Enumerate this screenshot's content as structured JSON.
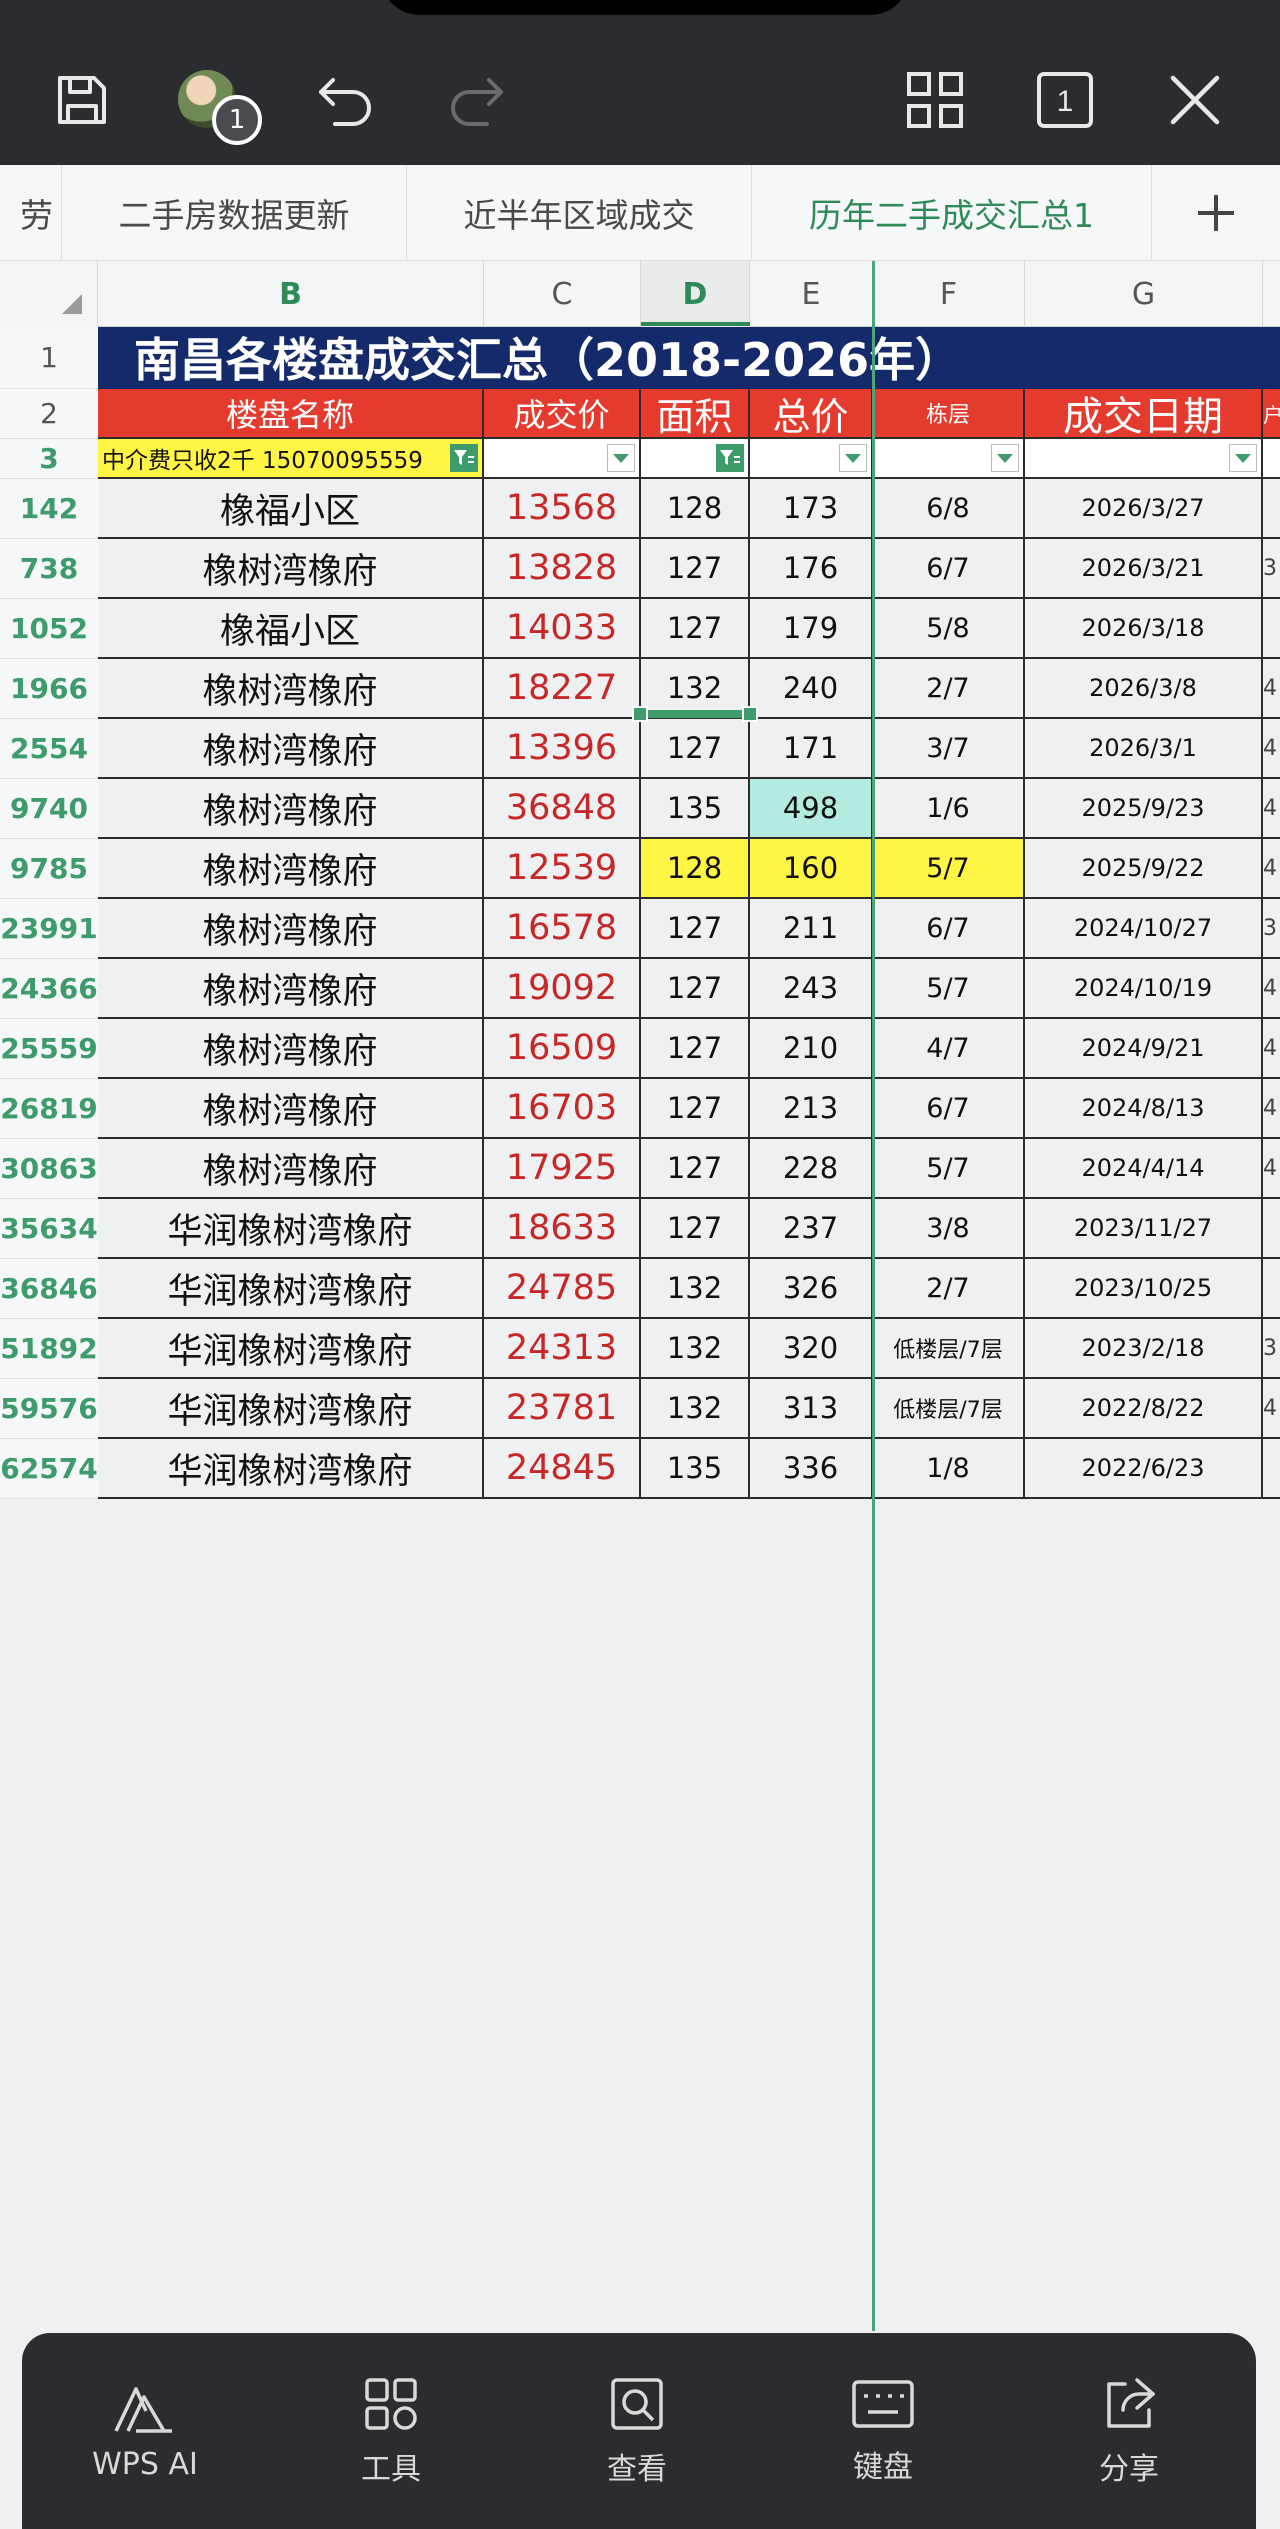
{
  "toolbar": {
    "avatar_badge": "1",
    "window_count": "1"
  },
  "tabs": [
    {
      "label": "劳"
    },
    {
      "label": "二手房数据更新"
    },
    {
      "label": "近半年区域成交"
    },
    {
      "label": "历年二手成交汇总1"
    }
  ],
  "columns": [
    "B",
    "C",
    "D",
    "E",
    "F",
    "G"
  ],
  "header_rows": {
    "r1": "1",
    "r2": "2",
    "r3": "3"
  },
  "sheet": {
    "title": "南昌各楼盘成交汇总（2018-2026年）",
    "headers": {
      "name": "楼盘名称",
      "price": "成交价",
      "area": "面积",
      "total": "总价",
      "floor": "栋层",
      "date": "成交日期",
      "extra": "户"
    },
    "filter_note": "中介费只收2千 15070095559"
  },
  "rows": [
    {
      "rn": "142",
      "name": "橡福小区",
      "price": "13568",
      "area": "128",
      "total": "173",
      "floor": "6/8",
      "date": "2026/3/27",
      "extra": ""
    },
    {
      "rn": "738",
      "name": "橡树湾橡府",
      "price": "13828",
      "area": "127",
      "total": "176",
      "floor": "6/7",
      "date": "2026/3/21",
      "extra": "3"
    },
    {
      "rn": "1052",
      "name": "橡福小区",
      "price": "14033",
      "area": "127",
      "total": "179",
      "floor": "5/8",
      "date": "2026/3/18",
      "extra": ""
    },
    {
      "rn": "1966",
      "name": "橡树湾橡府",
      "price": "18227",
      "area": "132",
      "total": "240",
      "floor": "2/7",
      "date": "2026/3/8",
      "extra": "4"
    },
    {
      "rn": "2554",
      "name": "橡树湾橡府",
      "price": "13396",
      "area": "127",
      "total": "171",
      "floor": "3/7",
      "date": "2026/3/1",
      "extra": "4"
    },
    {
      "rn": "9740",
      "name": "橡树湾橡府",
      "price": "36848",
      "area": "135",
      "total": "498",
      "floor": "1/6",
      "date": "2025/9/23",
      "extra": "4"
    },
    {
      "rn": "9785",
      "name": "橡树湾橡府",
      "price": "12539",
      "area": "128",
      "total": "160",
      "floor": "5/7",
      "date": "2025/9/22",
      "extra": "4"
    },
    {
      "rn": "23991",
      "name": "橡树湾橡府",
      "price": "16578",
      "area": "127",
      "total": "211",
      "floor": "6/7",
      "date": "2024/10/27",
      "extra": "3"
    },
    {
      "rn": "24366",
      "name": "橡树湾橡府",
      "price": "19092",
      "area": "127",
      "total": "243",
      "floor": "5/7",
      "date": "2024/10/19",
      "extra": "4"
    },
    {
      "rn": "25559",
      "name": "橡树湾橡府",
      "price": "16509",
      "area": "127",
      "total": "210",
      "floor": "4/7",
      "date": "2024/9/21",
      "extra": "4"
    },
    {
      "rn": "26819",
      "name": "橡树湾橡府",
      "price": "16703",
      "area": "127",
      "total": "213",
      "floor": "6/7",
      "date": "2024/8/13",
      "extra": "4"
    },
    {
      "rn": "30863",
      "name": "橡树湾橡府",
      "price": "17925",
      "area": "127",
      "total": "228",
      "floor": "5/7",
      "date": "2024/4/14",
      "extra": "4"
    },
    {
      "rn": "35634",
      "name": "华润橡树湾橡府",
      "price": "18633",
      "area": "127",
      "total": "237",
      "floor": "3/8",
      "date": "2023/11/27",
      "extra": ""
    },
    {
      "rn": "36846",
      "name": "华润橡树湾橡府",
      "price": "24785",
      "area": "132",
      "total": "326",
      "floor": "2/7",
      "date": "2023/10/25",
      "extra": ""
    },
    {
      "rn": "51892",
      "name": "华润橡树湾橡府",
      "price": "24313",
      "area": "132",
      "total": "320",
      "floor": "低楼层/7层",
      "date": "2023/2/18",
      "extra": "3"
    },
    {
      "rn": "59576",
      "name": "华润橡树湾橡府",
      "price": "23781",
      "area": "132",
      "total": "313",
      "floor": "低楼层/7层",
      "date": "2022/8/22",
      "extra": "4"
    },
    {
      "rn": "62574",
      "name": "华润橡树湾橡府",
      "price": "24845",
      "area": "135",
      "total": "336",
      "floor": "1/8",
      "date": "2022/6/23",
      "extra": ""
    }
  ],
  "bottom": {
    "ai": "WPS AI",
    "tools": "工具",
    "view": "查看",
    "keyboard": "键盘",
    "share": "分享"
  },
  "colors": {
    "accent": "#2f8a5a",
    "title_bg": "#142a6b",
    "header_bg": "#e53b2f",
    "price_red": "#c62828",
    "highlight_yellow": "#fff544",
    "highlight_teal": "#b4ebe0"
  }
}
